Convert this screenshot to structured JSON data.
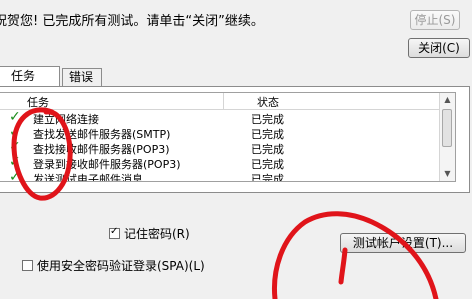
{
  "dialog": {
    "message": "祝贺您! 已完成所有测试。请单击“关闭”继续。",
    "stop_label": "停止(S)",
    "close_label": "关闭(C)"
  },
  "tabs": [
    {
      "label": "任务",
      "active": true
    },
    {
      "label": "错误",
      "active": false
    }
  ],
  "list": {
    "headers": {
      "task": "任务",
      "status": "状态"
    },
    "rows": [
      {
        "task": "建立网络连接",
        "status": "已完成"
      },
      {
        "task": "查找发送邮件服务器(SMTP)",
        "status": "已完成"
      },
      {
        "task": "查找接收邮件服务器(POP3)",
        "status": "已完成"
      },
      {
        "task": "登录到接收邮件服务器(POP3)",
        "status": "已完成"
      },
      {
        "task": "发送测试电子邮件消息",
        "status": "已完成"
      }
    ]
  },
  "settings": {
    "remember_password": {
      "label": "记住密码(R)",
      "checked": true
    },
    "spa": {
      "label": "使用安全密码验证登录(SPA)(L)",
      "checked": false
    },
    "test_button_label": "测试帐户设置(T)..."
  },
  "colors": {
    "annotation": "#e0141a",
    "check": "#1a8c1a"
  }
}
